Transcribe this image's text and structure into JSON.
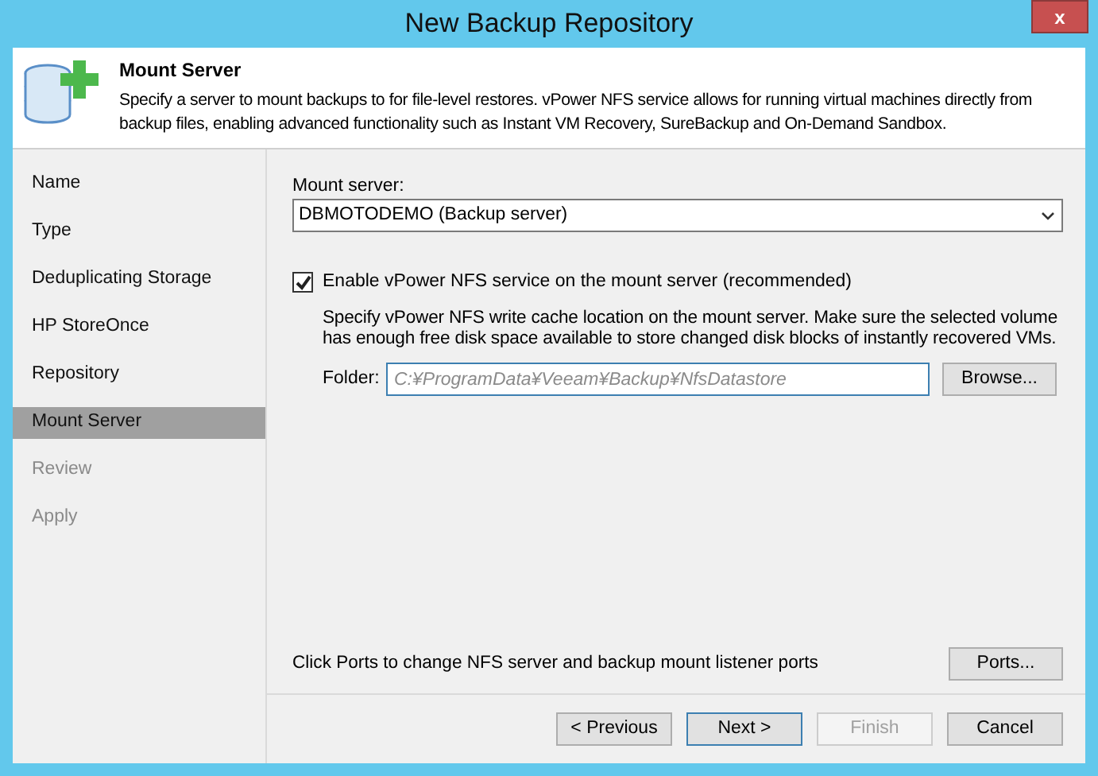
{
  "window": {
    "title": "New Backup Repository",
    "close": "x"
  },
  "header": {
    "title": "Mount Server",
    "description": "Specify a server to mount backups to for file-level restores. vPower NFS service allows for running virtual machines directly from backup files, enabling advanced functionality such as Instant VM Recovery, SureBackup and On-Demand Sandbox."
  },
  "steps": [
    {
      "label": "Name",
      "selected": false,
      "disabled": false
    },
    {
      "label": "Type",
      "selected": false,
      "disabled": false
    },
    {
      "label": "Deduplicating Storage",
      "selected": false,
      "disabled": false
    },
    {
      "label": "HP StoreOnce",
      "selected": false,
      "disabled": false
    },
    {
      "label": "Repository",
      "selected": false,
      "disabled": false
    },
    {
      "label": "Mount Server",
      "selected": true,
      "disabled": false
    },
    {
      "label": "Review",
      "selected": false,
      "disabled": true
    },
    {
      "label": "Apply",
      "selected": false,
      "disabled": true
    }
  ],
  "mount_server": {
    "label": "Mount server:",
    "value": "DBMOTODEMO (Backup server)"
  },
  "nfs": {
    "label": "Enable vPower NFS service on the mount server (recommended)",
    "checked": true,
    "description": "Specify vPower NFS write cache location on the mount server. Make sure the selected volume has enough free disk space available to store changed disk blocks of instantly recovered VMs.",
    "folder_label": "Folder:",
    "folder_placeholder": "C:¥ProgramData¥Veeam¥Backup¥NfsDatastore",
    "browse": "Browse..."
  },
  "ports": {
    "text": "Click Ports to change NFS server and backup mount listener ports",
    "button": "Ports..."
  },
  "buttons": [
    {
      "label": "< Previous",
      "default": false,
      "disabled": false
    },
    {
      "label": "Next >",
      "default": true,
      "disabled": false
    },
    {
      "label": "Finish",
      "default": false,
      "disabled": true
    },
    {
      "label": "Cancel",
      "default": false,
      "disabled": false
    }
  ]
}
